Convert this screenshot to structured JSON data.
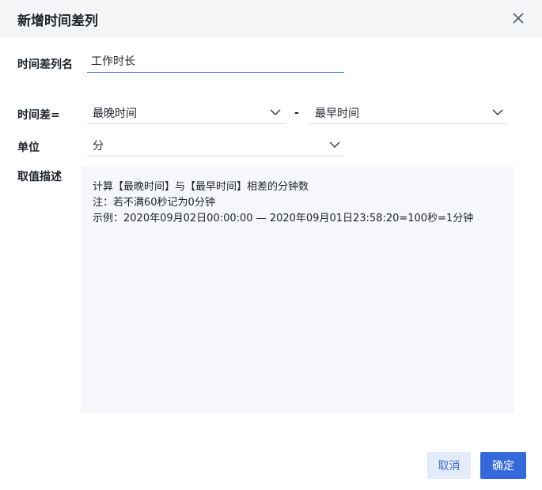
{
  "dialog": {
    "title": "新增时间差列",
    "close_icon": "close-icon"
  },
  "form": {
    "name_label": "时间差列名",
    "name_value": "工作时长",
    "diff_label": "时间差=",
    "diff_left_value": "最晚时间",
    "diff_separator": "-",
    "diff_right_value": "最早时间",
    "unit_label": "单位",
    "unit_value": "分",
    "desc_label": "取值描述",
    "desc_lines": [
      "计算【最晚时间】与【最早时间】相差的分钟数",
      "注：若不满60秒记为0分钟",
      "示例：2020年09月02日00:00:00 — 2020年09月01日23:58:20=100秒=1分钟"
    ]
  },
  "footer": {
    "cancel_label": "取消",
    "ok_label": "确定"
  },
  "colors": {
    "primary": "#3569db",
    "header_bg": "#f4f5f7",
    "desc_bg": "#f5f7fb"
  }
}
